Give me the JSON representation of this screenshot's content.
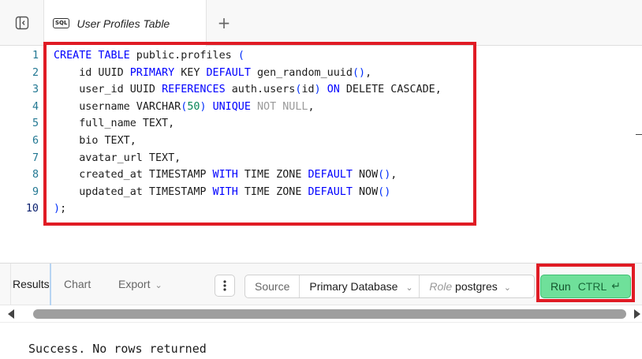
{
  "tab": {
    "badge": "SQL",
    "title": "User Profiles Table",
    "add_symbol": "+"
  },
  "editor": {
    "line_numbers": [
      "1",
      "2",
      "3",
      "4",
      "5",
      "6",
      "7",
      "8",
      "9",
      "10"
    ],
    "lines": [
      [
        {
          "t": "CREATE TABLE",
          "c": "kw"
        },
        {
          "t": " public.profiles "
        },
        {
          "t": "(",
          "c": "bracket"
        }
      ],
      [
        {
          "t": "    id UUID "
        },
        {
          "t": "PRIMARY",
          "c": "kw"
        },
        {
          "t": " KEY "
        },
        {
          "t": "DEFAULT",
          "c": "kw"
        },
        {
          "t": " gen_random_uuid"
        },
        {
          "t": "()",
          "c": "bracket"
        },
        {
          "t": ","
        }
      ],
      [
        {
          "t": "    user_id UUID "
        },
        {
          "t": "REFERENCES",
          "c": "kw"
        },
        {
          "t": " auth.users"
        },
        {
          "t": "(",
          "c": "bracket"
        },
        {
          "t": "id"
        },
        {
          "t": ")",
          "c": "bracket"
        },
        {
          "t": " "
        },
        {
          "t": "ON",
          "c": "kw"
        },
        {
          "t": " DELETE CASCADE,"
        }
      ],
      [
        {
          "t": "    username VARCHAR"
        },
        {
          "t": "(",
          "c": "bracket"
        },
        {
          "t": "50",
          "c": "num"
        },
        {
          "t": ")",
          "c": "bracket"
        },
        {
          "t": " "
        },
        {
          "t": "UNIQUE",
          "c": "kw"
        },
        {
          "t": " "
        },
        {
          "t": "NOT NULL",
          "c": "dim"
        },
        {
          "t": ","
        }
      ],
      [
        {
          "t": "    full_name TEXT,"
        }
      ],
      [
        {
          "t": "    bio TEXT,"
        }
      ],
      [
        {
          "t": "    avatar_url TEXT,"
        }
      ],
      [
        {
          "t": "    created_at TIMESTAMP "
        },
        {
          "t": "WITH",
          "c": "kw"
        },
        {
          "t": " TIME ZONE "
        },
        {
          "t": "DEFAULT",
          "c": "kw"
        },
        {
          "t": " NOW"
        },
        {
          "t": "()",
          "c": "bracket"
        },
        {
          "t": ","
        }
      ],
      [
        {
          "t": "    updated_at TIMESTAMP "
        },
        {
          "t": "WITH",
          "c": "kw"
        },
        {
          "t": " TIME ZONE "
        },
        {
          "t": "DEFAULT",
          "c": "kw"
        },
        {
          "t": " NOW"
        },
        {
          "t": "()",
          "c": "bracket"
        }
      ],
      [
        {
          "t": ")",
          "c": "bracket"
        },
        {
          "t": ";"
        }
      ]
    ]
  },
  "results_toolbar": {
    "tabs": {
      "results": "Results",
      "chart": "Chart",
      "export": "Export"
    },
    "source_label": "Source",
    "database": "Primary Database",
    "role_label": "Role",
    "role_value": "postgres",
    "run_label": "Run",
    "run_shortcut": "CTRL",
    "run_key_symbol": "↵"
  },
  "results": {
    "status": "Success. No rows returned"
  },
  "colors": {
    "highlight_box": "#e01b24",
    "run_button": "#6fe09a",
    "keyword": "#0000ff",
    "line_number": "#237893"
  }
}
